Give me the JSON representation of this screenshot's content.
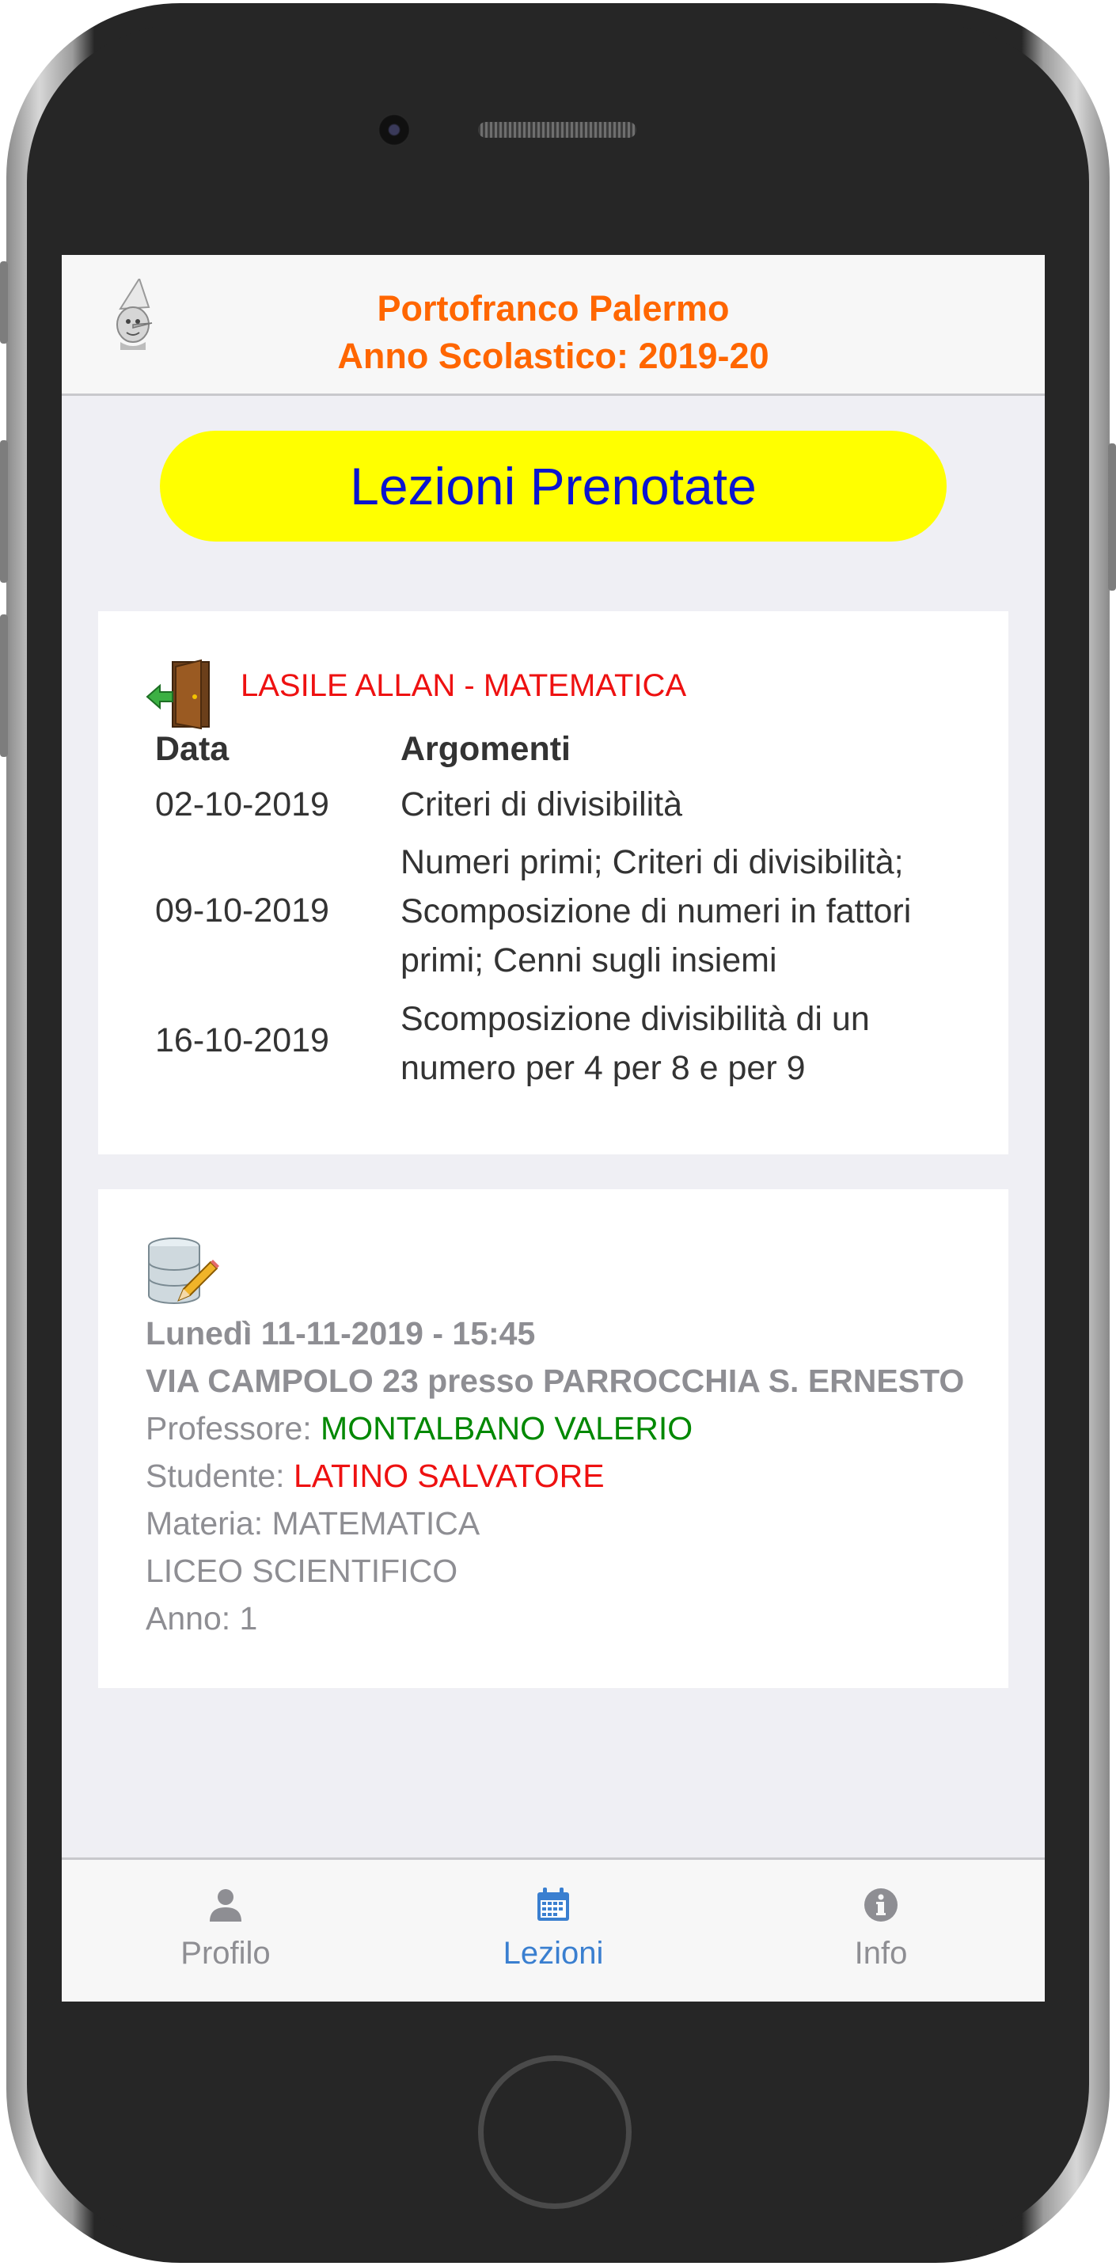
{
  "header": {
    "title_line1": "Portofranco Palermo",
    "title_line2": "Anno Scolastico: 2019-20",
    "logo_icon": "pinocchio-avatar-icon"
  },
  "page_title": "Lezioni Prenotate",
  "colors": {
    "header_text": "#ff6600",
    "pill_bg": "#ffff00",
    "pill_text": "#0a14d0",
    "highlight_red": "#ee1111",
    "highlight_green": "#008800",
    "tab_active": "#3a7fd0"
  },
  "lesson_card": {
    "icon": "door-exit-icon",
    "course": "LASILE ALLAN - MATEMATICA",
    "columns": [
      "Data",
      "Argomenti"
    ],
    "rows": [
      {
        "date": "02-10-2019",
        "topics": "Criteri di divisibilità"
      },
      {
        "date": "09-10-2019",
        "topics": "Numeri primi; Criteri di divisibilità; Scomposizione di numeri in fattori primi; Cenni sugli insiemi"
      },
      {
        "date": "16-10-2019",
        "topics": "Scomposizione divisibilità di un numero per 4 per 8 e per 9"
      }
    ]
  },
  "booking_card": {
    "icon": "database-edit-icon",
    "datetime": "Lunedì 11-11-2019 - 15:45",
    "location": "VIA CAMPOLO 23 presso PARROCCHIA S. ERNESTO",
    "professor_label": "Professore: ",
    "professor": "MONTALBANO VALERIO",
    "student_label": "Studente: ",
    "student": "LATINO SALVATORE",
    "subject": "Materia: MATEMATICA",
    "school": "LICEO SCIENTIFICO",
    "year": "Anno: 1"
  },
  "tabbar": {
    "tabs": [
      {
        "label": "Profilo",
        "icon": "user-icon",
        "active": false
      },
      {
        "label": "Lezioni",
        "icon": "calendar-icon",
        "active": true
      },
      {
        "label": "Info",
        "icon": "info-icon",
        "active": false
      }
    ]
  }
}
